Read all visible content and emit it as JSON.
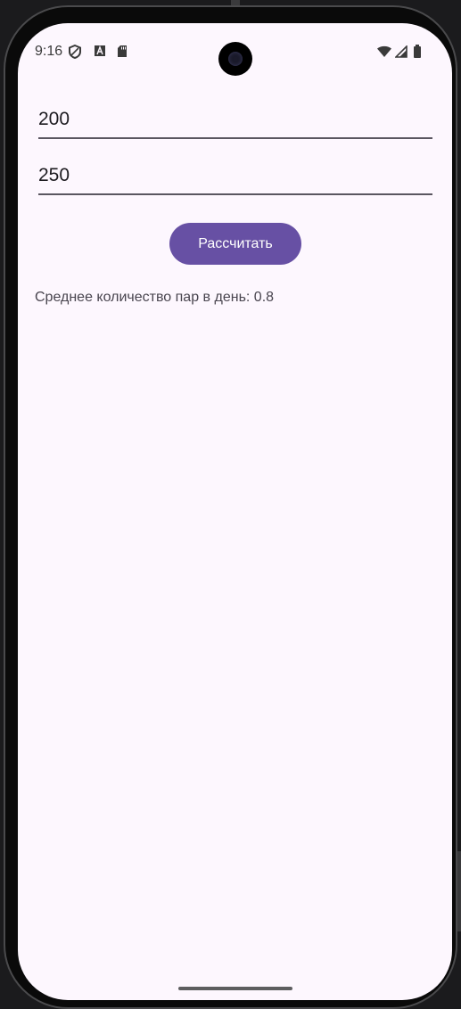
{
  "status_bar": {
    "time": "9:16",
    "left_icons": [
      "shield-icon",
      "font-a-icon",
      "sd-card-icon"
    ],
    "right_icons": [
      "wifi-icon",
      "cell-signal-icon",
      "battery-icon"
    ]
  },
  "form": {
    "field1_value": "200",
    "field2_value": "250",
    "calculate_label": "Рассчитать"
  },
  "result": {
    "text": "Среднее количество пар в день: 0.8"
  },
  "colors": {
    "accent": "#6750a4",
    "background": "#fdf7fe",
    "text": "#1d1b20",
    "secondary_text": "#49454f"
  }
}
